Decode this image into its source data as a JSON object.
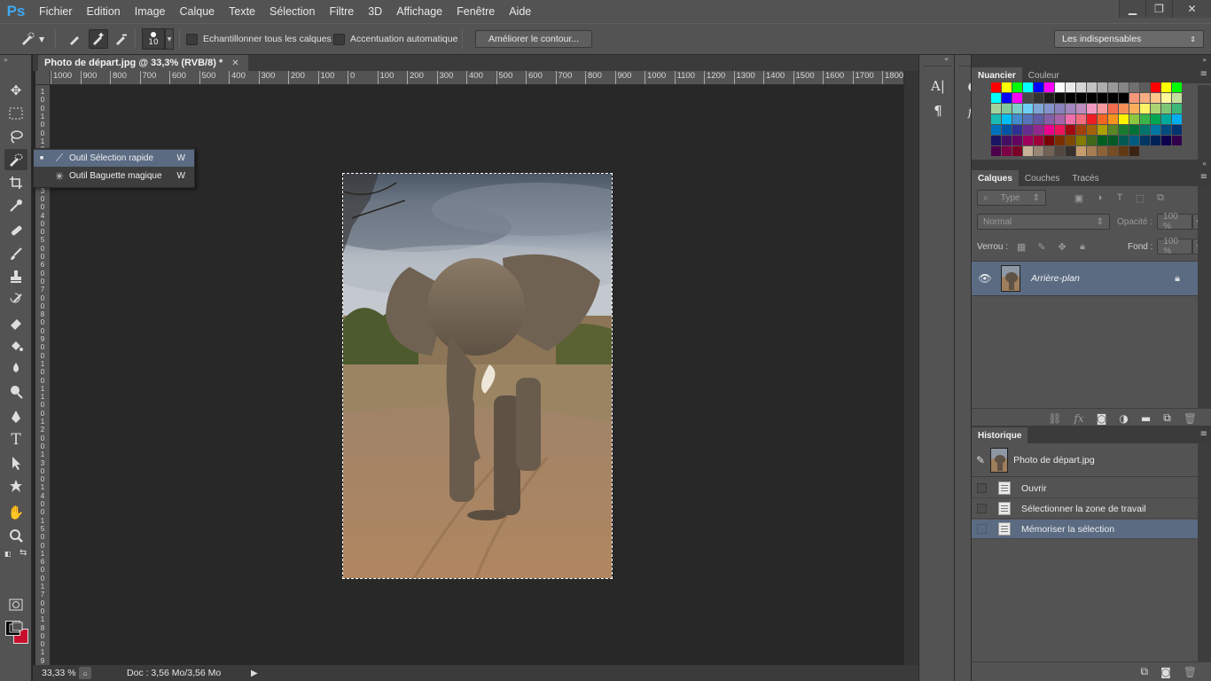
{
  "app": {
    "logo": "Ps",
    "menu": [
      "Fichier",
      "Edition",
      "Image",
      "Calque",
      "Texte",
      "Sélection",
      "Filtre",
      "3D",
      "Affichage",
      "Fenêtre",
      "Aide"
    ],
    "window_controls": {
      "minimize": "▁",
      "restore": "❐",
      "close": "✕"
    }
  },
  "options_bar": {
    "brush_size": "10",
    "sample_all_layers_label": "Echantillonner tous les calques",
    "auto_enhance_label": "Accentuation automatique",
    "refine_edge_button": "Améliorer le contour...",
    "workspace_select": "Les indispensables"
  },
  "flyout": {
    "items": [
      {
        "label": "Outil Sélection rapide",
        "key": "W",
        "selected": true
      },
      {
        "label": "Outil Baguette magique",
        "key": "W",
        "selected": false
      }
    ]
  },
  "document": {
    "tab_title": "Photo de départ.jpg @ 33,3% (RVB/8) *",
    "close": "✕",
    "ruler_h": [
      "1000",
      "900",
      "800",
      "700",
      "600",
      "500",
      "400",
      "300",
      "200",
      "100",
      "0",
      "100",
      "200",
      "300",
      "400",
      "500",
      "600",
      "700",
      "800",
      "900",
      "1000",
      "1100",
      "1200",
      "1300",
      "1400",
      "1500",
      "1600",
      "1700",
      "1800"
    ],
    "ruler_v": [
      "1",
      "0",
      "0",
      "1",
      "0",
      "0",
      "1",
      "0",
      "0",
      "2",
      "0",
      "0",
      "3",
      "0",
      "0",
      "4",
      "0",
      "0",
      "5",
      "0",
      "0",
      "6",
      "0",
      "0",
      "7",
      "0",
      "0",
      "8",
      "0",
      "0",
      "9",
      "0",
      "0",
      "1",
      "0",
      "0",
      "1",
      "1",
      "0",
      "0",
      "1",
      "2",
      "0",
      "0",
      "1",
      "3",
      "0",
      "0",
      "1",
      "4",
      "0",
      "0",
      "1",
      "5",
      "0",
      "0",
      "1",
      "6",
      "0",
      "0",
      "1",
      "7",
      "0",
      "0",
      "1",
      "8",
      "0",
      "0",
      "1",
      "9"
    ]
  },
  "status_bar": {
    "zoom": "33,33 %",
    "doc_info": "Doc : 3,56 Mo/3,56 Mo"
  },
  "swatches_panel": {
    "tabs": [
      "Nuancier",
      "Couleur"
    ],
    "colors": [
      "#ff0000",
      "#ffff00",
      "#00ff00",
      "#00ffff",
      "#0000ff",
      "#ff00ff",
      "#ffffff",
      "#ebebeb",
      "#d6d6d6",
      "#c2c2c2",
      "#adadad",
      "#999999",
      "#858585",
      "#707070",
      "#5c5c5c",
      "#ff0000",
      "#ffff00",
      "#00ff00",
      "#00ffff",
      "#0000ff",
      "#ff00ff",
      "#474747",
      "#333333",
      "#1f1f1f",
      "#0a0a0a",
      "#000000",
      "#000000",
      "#000000",
      "#000000",
      "#000000",
      "#000000",
      "#f7977a",
      "#f9ad81",
      "#fdc68a",
      "#fff79a",
      "#c4df9b",
      "#a3d39c",
      "#82ca9d",
      "#7bcdc8",
      "#6ecff6",
      "#7ea7d8",
      "#8493ca",
      "#8882be",
      "#a187be",
      "#bc8dbf",
      "#f49ac2",
      "#f6989d",
      "#f26c4f",
      "#f68e55",
      "#fbaf5c",
      "#fff467",
      "#acd372",
      "#7cc576",
      "#3bb878",
      "#1abbb4",
      "#00bff3",
      "#438ccb",
      "#5574b9",
      "#605ca8",
      "#855fa8",
      "#a763a8",
      "#f06ea9",
      "#f26d7d",
      "#ed1c24",
      "#f26522",
      "#f7941d",
      "#fff200",
      "#8dc63f",
      "#39b54a",
      "#00a651",
      "#00a99d",
      "#00aeef",
      "#0072bc",
      "#0054a6",
      "#2e3192",
      "#662d91",
      "#92278f",
      "#ec008c",
      "#ed145b",
      "#9e0b0f",
      "#a0410d",
      "#a36209",
      "#aba000",
      "#598527",
      "#1a7b30",
      "#007236",
      "#00746b",
      "#0076a3",
      "#004b80",
      "#003471",
      "#1b1464",
      "#440e62",
      "#630460",
      "#9e005d",
      "#9e0039",
      "#790000",
      "#7b2e00",
      "#7d4900",
      "#827b00",
      "#406618",
      "#005e20",
      "#005826",
      "#005952",
      "#005b7f",
      "#003663",
      "#002157",
      "#0d004c",
      "#32004b",
      "#4b0049",
      "#7b0046",
      "#7a0026",
      "#c7b299",
      "#998675",
      "#736357",
      "#534741",
      "#37302d",
      "#c69c6d",
      "#a67c52",
      "#8c6239",
      "#754c24",
      "#603913",
      "#3c2415"
    ]
  },
  "layers_panel": {
    "tabs": [
      "Calques",
      "Couches",
      "Tracés"
    ],
    "filter_type": "Type",
    "blend_mode": "Normal",
    "opacity_label": "Opacité :",
    "opacity_value": "100 %",
    "lock_label": "Verrou :",
    "fill_label": "Fond :",
    "fill_value": "100 %",
    "layer_name": "Arrière-plan"
  },
  "history_panel": {
    "tab": "Historique",
    "snapshot": "Photo de départ.jpg",
    "states": [
      {
        "label": "Ouvrir",
        "selected": false
      },
      {
        "label": "Sélectionner la zone de travail",
        "selected": false
      },
      {
        "label": "Mémoriser la sélection",
        "selected": true
      }
    ]
  }
}
